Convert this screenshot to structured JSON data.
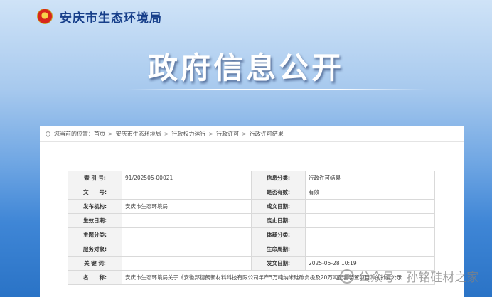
{
  "site": {
    "name": "安庆市生态环境局",
    "emblem_icon": "national-emblem-icon"
  },
  "banner": {
    "title": "政府信息公开"
  },
  "breadcrumb": {
    "prefix": "您当前的位置：",
    "items": [
      "首页",
      "安庆市生态环境局",
      "行政权力运行",
      "行政许可",
      "行政许可结果"
    ]
  },
  "table": {
    "rows": [
      [
        {
          "label": "索 引 号:",
          "value": "91/202505-00021"
        },
        {
          "label": "信息分类:",
          "value": "行政许可结果"
        }
      ],
      [
        {
          "label": "文　　号:",
          "value": ""
        },
        {
          "label": "是否有效:",
          "value": "有效"
        }
      ],
      [
        {
          "label": "发布机构:",
          "value": "安庆市生态环境局"
        },
        {
          "label": "成文日期:",
          "value": ""
        }
      ],
      [
        {
          "label": "生效日期:",
          "value": ""
        },
        {
          "label": "废止日期:",
          "value": ""
        }
      ],
      [
        {
          "label": "主题分类:",
          "value": ""
        },
        {
          "label": "体裁分类:",
          "value": ""
        }
      ],
      [
        {
          "label": "服务对象:",
          "value": ""
        },
        {
          "label": "生命周期:",
          "value": ""
        }
      ],
      [
        {
          "label": "关 键 词:",
          "value": ""
        },
        {
          "label": "发文日期:",
          "value": "2025-05-28 10:19"
        }
      ]
    ],
    "name_row": {
      "label": "名　　称:",
      "value": "安庆市生态环境局关于《安徽邦德朗新材料科技有限公司年产5万吨纳米硅碳负极及20万吨配套装置项目》的批复公示"
    }
  },
  "watermark": {
    "text": "公众号 · 孙铭硅材之家"
  }
}
